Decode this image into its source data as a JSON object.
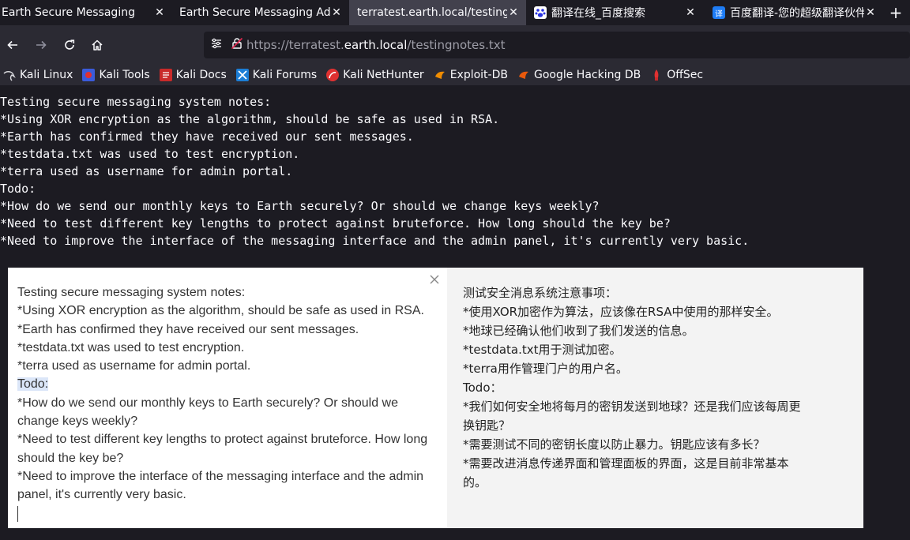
{
  "tabs": [
    {
      "label": "Earth Secure Messaging",
      "icon": "none",
      "active": false
    },
    {
      "label": "Earth Secure Messaging Admin",
      "icon": "none",
      "active": false
    },
    {
      "label": "terratest.earth.local/testingnotes.txt",
      "icon": "none",
      "active": true
    },
    {
      "label": "翻译在线_百度搜索",
      "icon": "baidu-icon",
      "active": false
    },
    {
      "label": "百度翻译-您的超级翻译伙伴",
      "icon": "baidu-translate-icon",
      "badge": "译",
      "active": false
    }
  ],
  "new_tab": "+",
  "close_glyph": "✕",
  "url": {
    "prefix": "https://terratest.",
    "host": "earth.local",
    "path": "/testingnotes.txt"
  },
  "bookmarks": [
    {
      "label": "Kali Linux",
      "icon": "kali-dragon-icon"
    },
    {
      "label": "Kali Tools",
      "icon": "kali-tools-icon"
    },
    {
      "label": "Kali Docs",
      "icon": "kali-docs-icon"
    },
    {
      "label": "Kali Forums",
      "icon": "kali-forums-icon"
    },
    {
      "label": "Kali NetHunter",
      "icon": "kali-nethunter-icon"
    },
    {
      "label": "Exploit-DB",
      "icon": "exploit-db-icon"
    },
    {
      "label": "Google Hacking DB",
      "icon": "ghdb-icon"
    },
    {
      "label": "OffSec",
      "icon": "offsec-icon"
    }
  ],
  "page_text": "Testing secure messaging system notes:\n*Using XOR encryption as the algorithm, should be safe as used in RSA.\n*Earth has confirmed they have received our sent messages.\n*testdata.txt was used to test encryption.\n*terra used as username for admin portal.\nTodo:\n*How do we send our monthly keys to Earth securely? Or should we change keys weekly?\n*Need to test different key lengths to protect against bruteforce. How long should the key be?\n*Need to improve the interface of the messaging interface and the admin panel, it's currently very basic.",
  "translator": {
    "source_lines": [
      "Testing secure messaging system notes:",
      "*Using XOR encryption as the algorithm, should be safe as used in RSA.",
      "*Earth has confirmed they have received our sent messages.",
      "*testdata.txt was used to test encryption.",
      "*terra used as username for admin portal.",
      "Todo:",
      "*How do we send our monthly keys to Earth securely? Or should we",
      "change keys weekly?",
      "*Need to test different key lengths to protect against bruteforce. How long",
      "should the key be?",
      "*Need to improve the interface of the messaging interface and the admin",
      "panel, it's currently very basic."
    ],
    "highlighted_line": 5,
    "target_lines": [
      "测试安全消息系统注意事项：",
      "*使用XOR加密作为算法，应该像在RSA中使用的那样安全。",
      "*地球已经确认他们收到了我们发送的信息。",
      "*testdata.txt用于测试加密。",
      "*terra用作管理门户的用户名。",
      "Todo：",
      "*我们如何安全地将每月的密钥发送到地球？还是我们应该每周更",
      "换钥匙？",
      "*需要测试不同的密钥长度以防止暴力。钥匙应该有多长？",
      "*需要改进消息传递界面和管理面板的界面，这是目前非常基本",
      "的。"
    ]
  }
}
